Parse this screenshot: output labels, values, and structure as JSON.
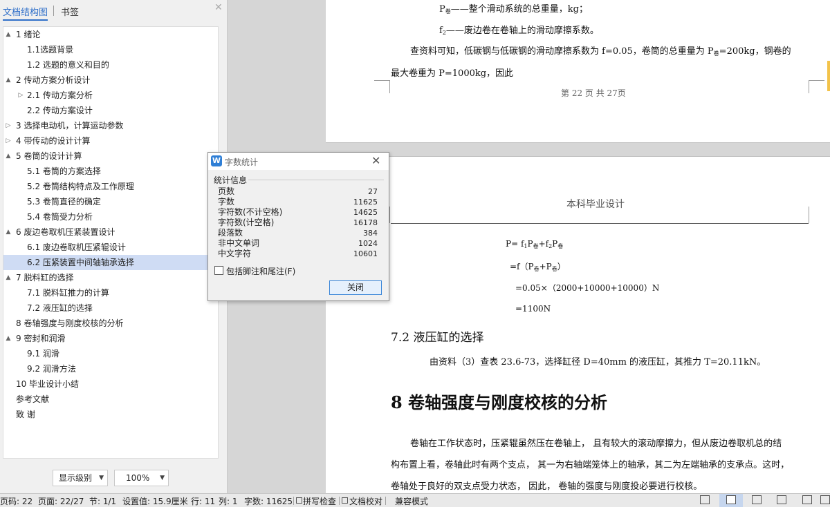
{
  "nav": {
    "tabs": [
      "文档结构图",
      "书签"
    ],
    "close_glyph": "✕",
    "outline": [
      {
        "label": "1   绪论",
        "indent": 0,
        "toggle": "▲"
      },
      {
        "label": "1.1选题背景",
        "indent": 1,
        "toggle": ""
      },
      {
        "label": "1.2 选题的意义和目的",
        "indent": 1,
        "toggle": ""
      },
      {
        "label": "2   传动方案分析设计",
        "indent": 0,
        "toggle": "▲"
      },
      {
        "label": "2.1 传动方案分析",
        "indent": 1,
        "toggle": "▷"
      },
      {
        "label": "2.2   传动方案设计",
        "indent": 1,
        "toggle": ""
      },
      {
        "label": "3   选择电动机，计算运动参数",
        "indent": 0,
        "toggle": "▷"
      },
      {
        "label": "4   带传动的设计计算",
        "indent": 0,
        "toggle": "▷"
      },
      {
        "label": "5   卷筒的设计计算",
        "indent": 0,
        "toggle": "▲"
      },
      {
        "label": "5.1 卷筒的方案选择",
        "indent": 1,
        "toggle": ""
      },
      {
        "label": "5.2  卷筒结构特点及工作原理",
        "indent": 1,
        "toggle": ""
      },
      {
        "label": "5.3  卷筒直径的确定",
        "indent": 1,
        "toggle": ""
      },
      {
        "label": "5.4  卷筒受力分析",
        "indent": 1,
        "toggle": ""
      },
      {
        "label": "6   废边卷取机压紧装置设计",
        "indent": 0,
        "toggle": "▲"
      },
      {
        "label": "6.1   废边卷取机压紧辊设计",
        "indent": 1,
        "toggle": ""
      },
      {
        "label": "6.2   压紧装置中间轴轴承选择",
        "indent": 1,
        "toggle": "",
        "selected": true
      },
      {
        "label": "7   脱料缸的选择",
        "indent": 0,
        "toggle": "▲"
      },
      {
        "label": "7.1   脱料缸推力的计算",
        "indent": 1,
        "toggle": ""
      },
      {
        "label": "7.2   液压缸的选择",
        "indent": 1,
        "toggle": ""
      },
      {
        "label": "8   卷轴强度与刚度校核的分析",
        "indent": 0,
        "toggle": ""
      },
      {
        "label": "9   密封和润滑",
        "indent": 0,
        "toggle": "▲"
      },
      {
        "label": "9.1 润滑",
        "indent": 1,
        "toggle": ""
      },
      {
        "label": "9.2  润滑方法",
        "indent": 1,
        "toggle": ""
      },
      {
        "label": "10   毕业设计小结",
        "indent": 0,
        "toggle": ""
      },
      {
        "label": "参考文献",
        "indent": 0,
        "toggle": ""
      },
      {
        "label": "致   谢",
        "indent": 0,
        "toggle": ""
      }
    ],
    "level_dropdown": "显示级别",
    "zoom_dropdown": "100%",
    "dropdown_arrow": "▼"
  },
  "document": {
    "page1": {
      "line1_pre": "P",
      "line1_sub": "卷",
      "line1_post": "——整个滑动系统的总重量，kg；",
      "line2_pre": "f",
      "line2_sub": "2",
      "line2_post": "——废边卷在卷轴上的滑动摩擦系数。",
      "line3_pre": "查资料可知，低碳钢与低碳钢的滑动摩擦系数为 f=0.05，卷筒的总重量为 P",
      "line3_sub": "卷",
      "line3_post": "=200kg，钢卷的",
      "line4": "最大卷重为 P=1000kg，因此",
      "footer": "第  22 页     共 27页"
    },
    "page2": {
      "header": "本科毕业设计",
      "formula1": "P= f",
      "formula1_rest": "P",
      "formula1_tail": "+f",
      "formula1_tail2": "P",
      "sub1": "1",
      "sub_juan": "卷",
      "sub2": "2",
      "formula2_pre": "=f（P",
      "formula2_mid": "+P",
      "formula2_post": "）",
      "formula3": "=0.05×（2000+10000+10000）N",
      "formula4": "=1100N",
      "heading72": "7.2   液压缸的选择",
      "para72": "由资料（3）查表 23.6-73，选择缸径 D=40mm 的液压缸，其推力 T=20.11kN。",
      "heading8": "8   卷轴强度与刚度校核的分析",
      "para8_line1": "卷轴在工作状态时，压紧辊虽然压在卷轴上， 且有较大的滚动摩擦力，但从废边卷取机总的结",
      "para8_line2": "构布置上看，卷轴此时有两个支点， 其一为右轴端笼体上的轴承，其二为左端轴承的支承点。这时，",
      "para8_line3": "卷轴处于良好的双支点受力状态，  因此，  卷轴的强度与刚度投必要进行校核。"
    }
  },
  "dialog": {
    "icon_letter": "W",
    "title": "字数统计",
    "close_glyph": "✕",
    "section": "统计信息",
    "stats": [
      {
        "label": "页数",
        "value": "27"
      },
      {
        "label": "字数",
        "value": "11625"
      },
      {
        "label": "字符数(不计空格)",
        "value": "14625"
      },
      {
        "label": "字符数(计空格)",
        "value": "16178"
      },
      {
        "label": "段落数",
        "value": "384"
      },
      {
        "label": "非中文单词",
        "value": "1024"
      },
      {
        "label": "中文字符",
        "value": "10601"
      }
    ],
    "checkbox_label": "包括脚注和尾注(F)",
    "checkbox_checked": false,
    "ok_button": "关闭"
  },
  "status": {
    "pagecode": "页码: 22",
    "page": "页面: 22/27",
    "section": "节: 1/1",
    "setting": "设置值: 15.9厘米",
    "line": "行: 11",
    "column": "列: 1",
    "wordcount": "字数: 11625",
    "spellcheck": "拼写检查",
    "proofread": "文档校对",
    "compat": "兼容模式"
  }
}
